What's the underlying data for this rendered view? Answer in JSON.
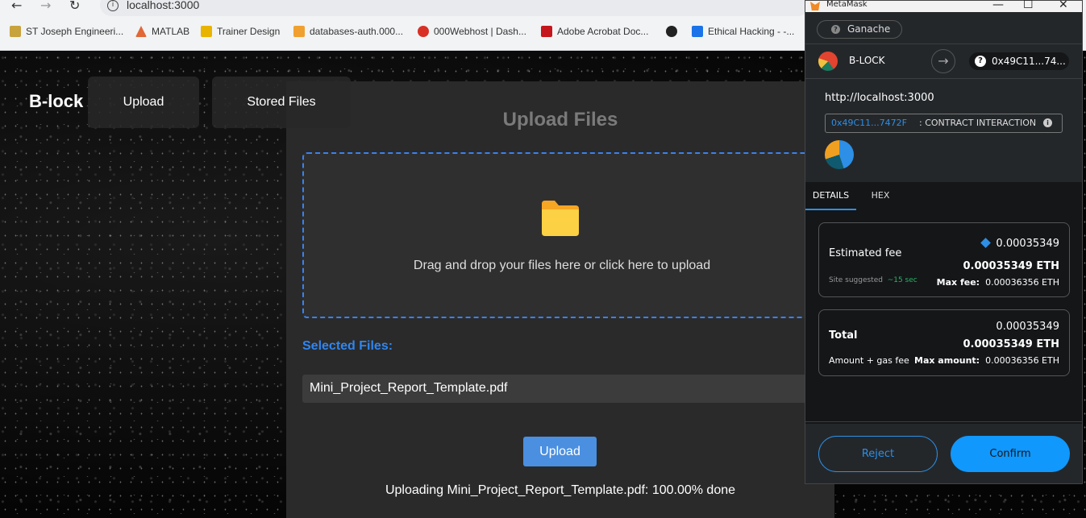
{
  "browser": {
    "url": "localhost:3000",
    "bookmarks": [
      {
        "label": "ST Joseph Engineeri...",
        "icon": "college-favicon",
        "color": "#c8a23c"
      },
      {
        "label": "MATLAB",
        "icon": "matlab-favicon",
        "color": "#e16737"
      },
      {
        "label": "Trainer Design",
        "icon": "trainer-favicon",
        "color": "#e8b400"
      },
      {
        "label": "databases-auth.000...",
        "icon": "phpmyadmin-favicon",
        "color": "#f0a030"
      },
      {
        "label": "000Webhost | Dash...",
        "icon": "webhost-favicon",
        "color": "#d93025"
      },
      {
        "label": "Adobe Acrobat Doc...",
        "icon": "acrobat-favicon",
        "color": "#c4161c"
      },
      {
        "label": "",
        "icon": "globe-favicon",
        "color": "#222222"
      },
      {
        "label": "Ethical Hacking - -...",
        "icon": "hacking-favicon",
        "color": "#1a73e8"
      }
    ]
  },
  "app": {
    "brand": "B-lock",
    "nav": {
      "upload": "Upload",
      "stored": "Stored Files"
    },
    "panel_title": "Upload Files",
    "drop_text": "Drag and drop your files here or click here to upload",
    "selected_label": "Selected Files:",
    "selected_file": "Mini_Project_Report_Template.pdf",
    "upload_button": "Upload",
    "status": "Uploading Mini_Project_Report_Template.pdf: 100.00% done",
    "accent_color": "#2f86f0"
  },
  "metamask": {
    "window_title": "MetaMask",
    "network": "Ganache",
    "account_name": "B-LOCK",
    "to_address": "0x49C11...74...",
    "origin": "http://localhost:3000",
    "contract_address": "0x49C11...7472F",
    "contract_label": ": CONTRACT INTERACTION",
    "tabs": {
      "details": "DETAILS",
      "hex": "HEX"
    },
    "fee": {
      "label": "Estimated fee",
      "value": "0.00035349",
      "value_eth": "0.00035349 ETH",
      "site_suggested": "Site suggested",
      "time": "~15 sec",
      "max_label": "Max fee:",
      "max_value": "0.00036356 ETH"
    },
    "total": {
      "label": "Total",
      "value": "0.00035349",
      "value_eth": "0.00035349 ETH",
      "sub_label": "Amount + gas fee",
      "max_label": "Max amount:",
      "max_value": "0.00036356 ETH"
    },
    "reject": "Reject",
    "confirm": "Confirm",
    "accent_color": "#1098fc"
  }
}
